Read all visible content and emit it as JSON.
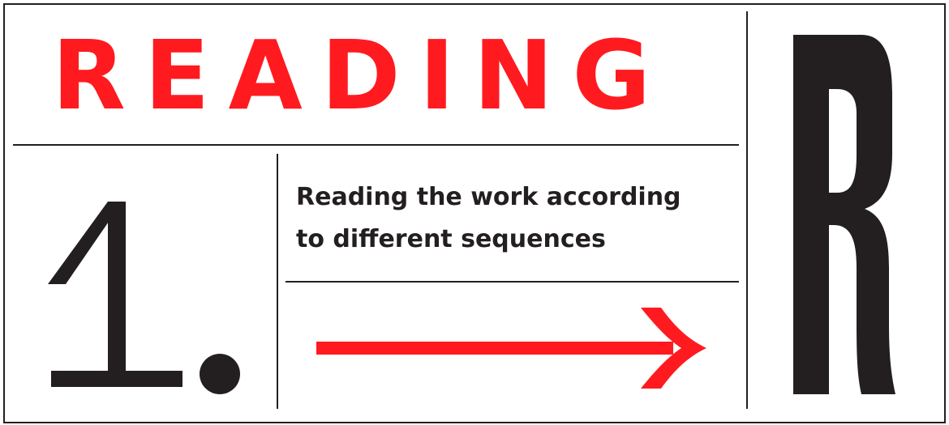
{
  "title": "READING",
  "step": {
    "number": "1",
    "punctuation": "."
  },
  "description": {
    "line1": "Reading the work according",
    "line2": "to different sequences"
  },
  "side_letter": "R",
  "colors": {
    "accent": "#ff1a1f",
    "ink": "#231f20",
    "background": "#ffffff"
  },
  "icons": {
    "arrow": "arrow-right-icon"
  }
}
